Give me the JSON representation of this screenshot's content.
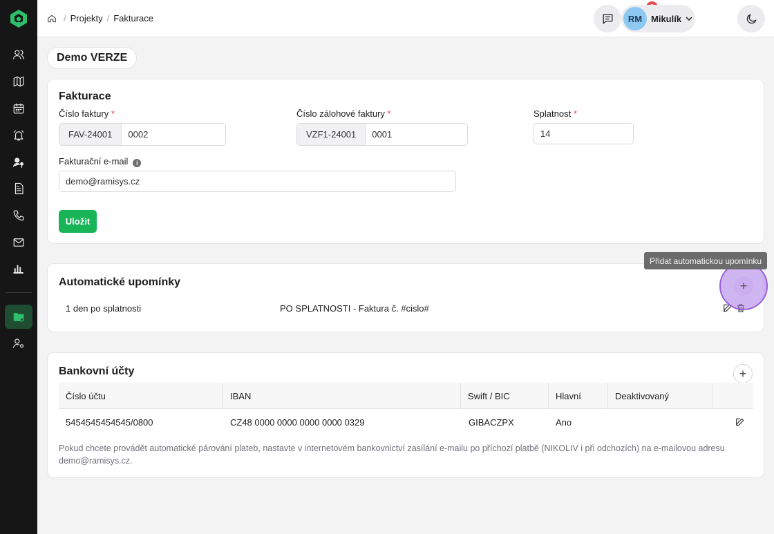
{
  "breadcrumb": {
    "items": [
      "Projekty",
      "Fakturace"
    ]
  },
  "header": {
    "notifications_count": "3",
    "user_initials": "RM",
    "user_name": "Mikulík"
  },
  "page": {
    "title": "Demo VERZE"
  },
  "billing": {
    "title": "Fakturace",
    "invoice_number_label": "Číslo faktury",
    "invoice_prefix": "FAV-24001",
    "invoice_value": "0002",
    "deposit_label": "Číslo zálohové faktury",
    "deposit_prefix": "VZF1-24001",
    "deposit_value": "0001",
    "due_label": "Splatnost",
    "due_value": "14",
    "email_label": "Fakturační e-mail",
    "email_value": "demo@ramisys.cz",
    "save_label": "Uložit",
    "required_mark": "*",
    "info_glyph": "i"
  },
  "reminders": {
    "title": "Automatické upomínky",
    "tooltip": "Přidat automatickou upomínku",
    "add_glyph": "+",
    "rows": [
      {
        "when": "1 den po splatnosti",
        "subject": "PO SPLATNOSTI - Faktura č. #cislo#"
      }
    ]
  },
  "bank_accounts": {
    "title": "Bankovní účty",
    "add_glyph": "+",
    "columns": [
      "Číslo účtu",
      "IBAN",
      "Swift / BIC",
      "Hlavní",
      "Deaktivovaný"
    ],
    "rows": [
      {
        "number": "5454545454545/0800",
        "iban": "CZ48 0000 0000 0000 0000 0329",
        "swift": "GIBACZPX",
        "main": "Ano",
        "deactivated": ""
      }
    ],
    "note": "Pokud chcete provádět automatické párování plateb, nastavte v internetovém bankovnictví zasílání e-mailu po příchozí platbě (NIKOLIV i při odchozích) na e-mailovou adresu demo@ramisys.cz."
  },
  "colors": {
    "accent": "#18b457",
    "sidebar": "#161617",
    "badge": "#e5484d",
    "highlight": "#9a5fd9"
  }
}
